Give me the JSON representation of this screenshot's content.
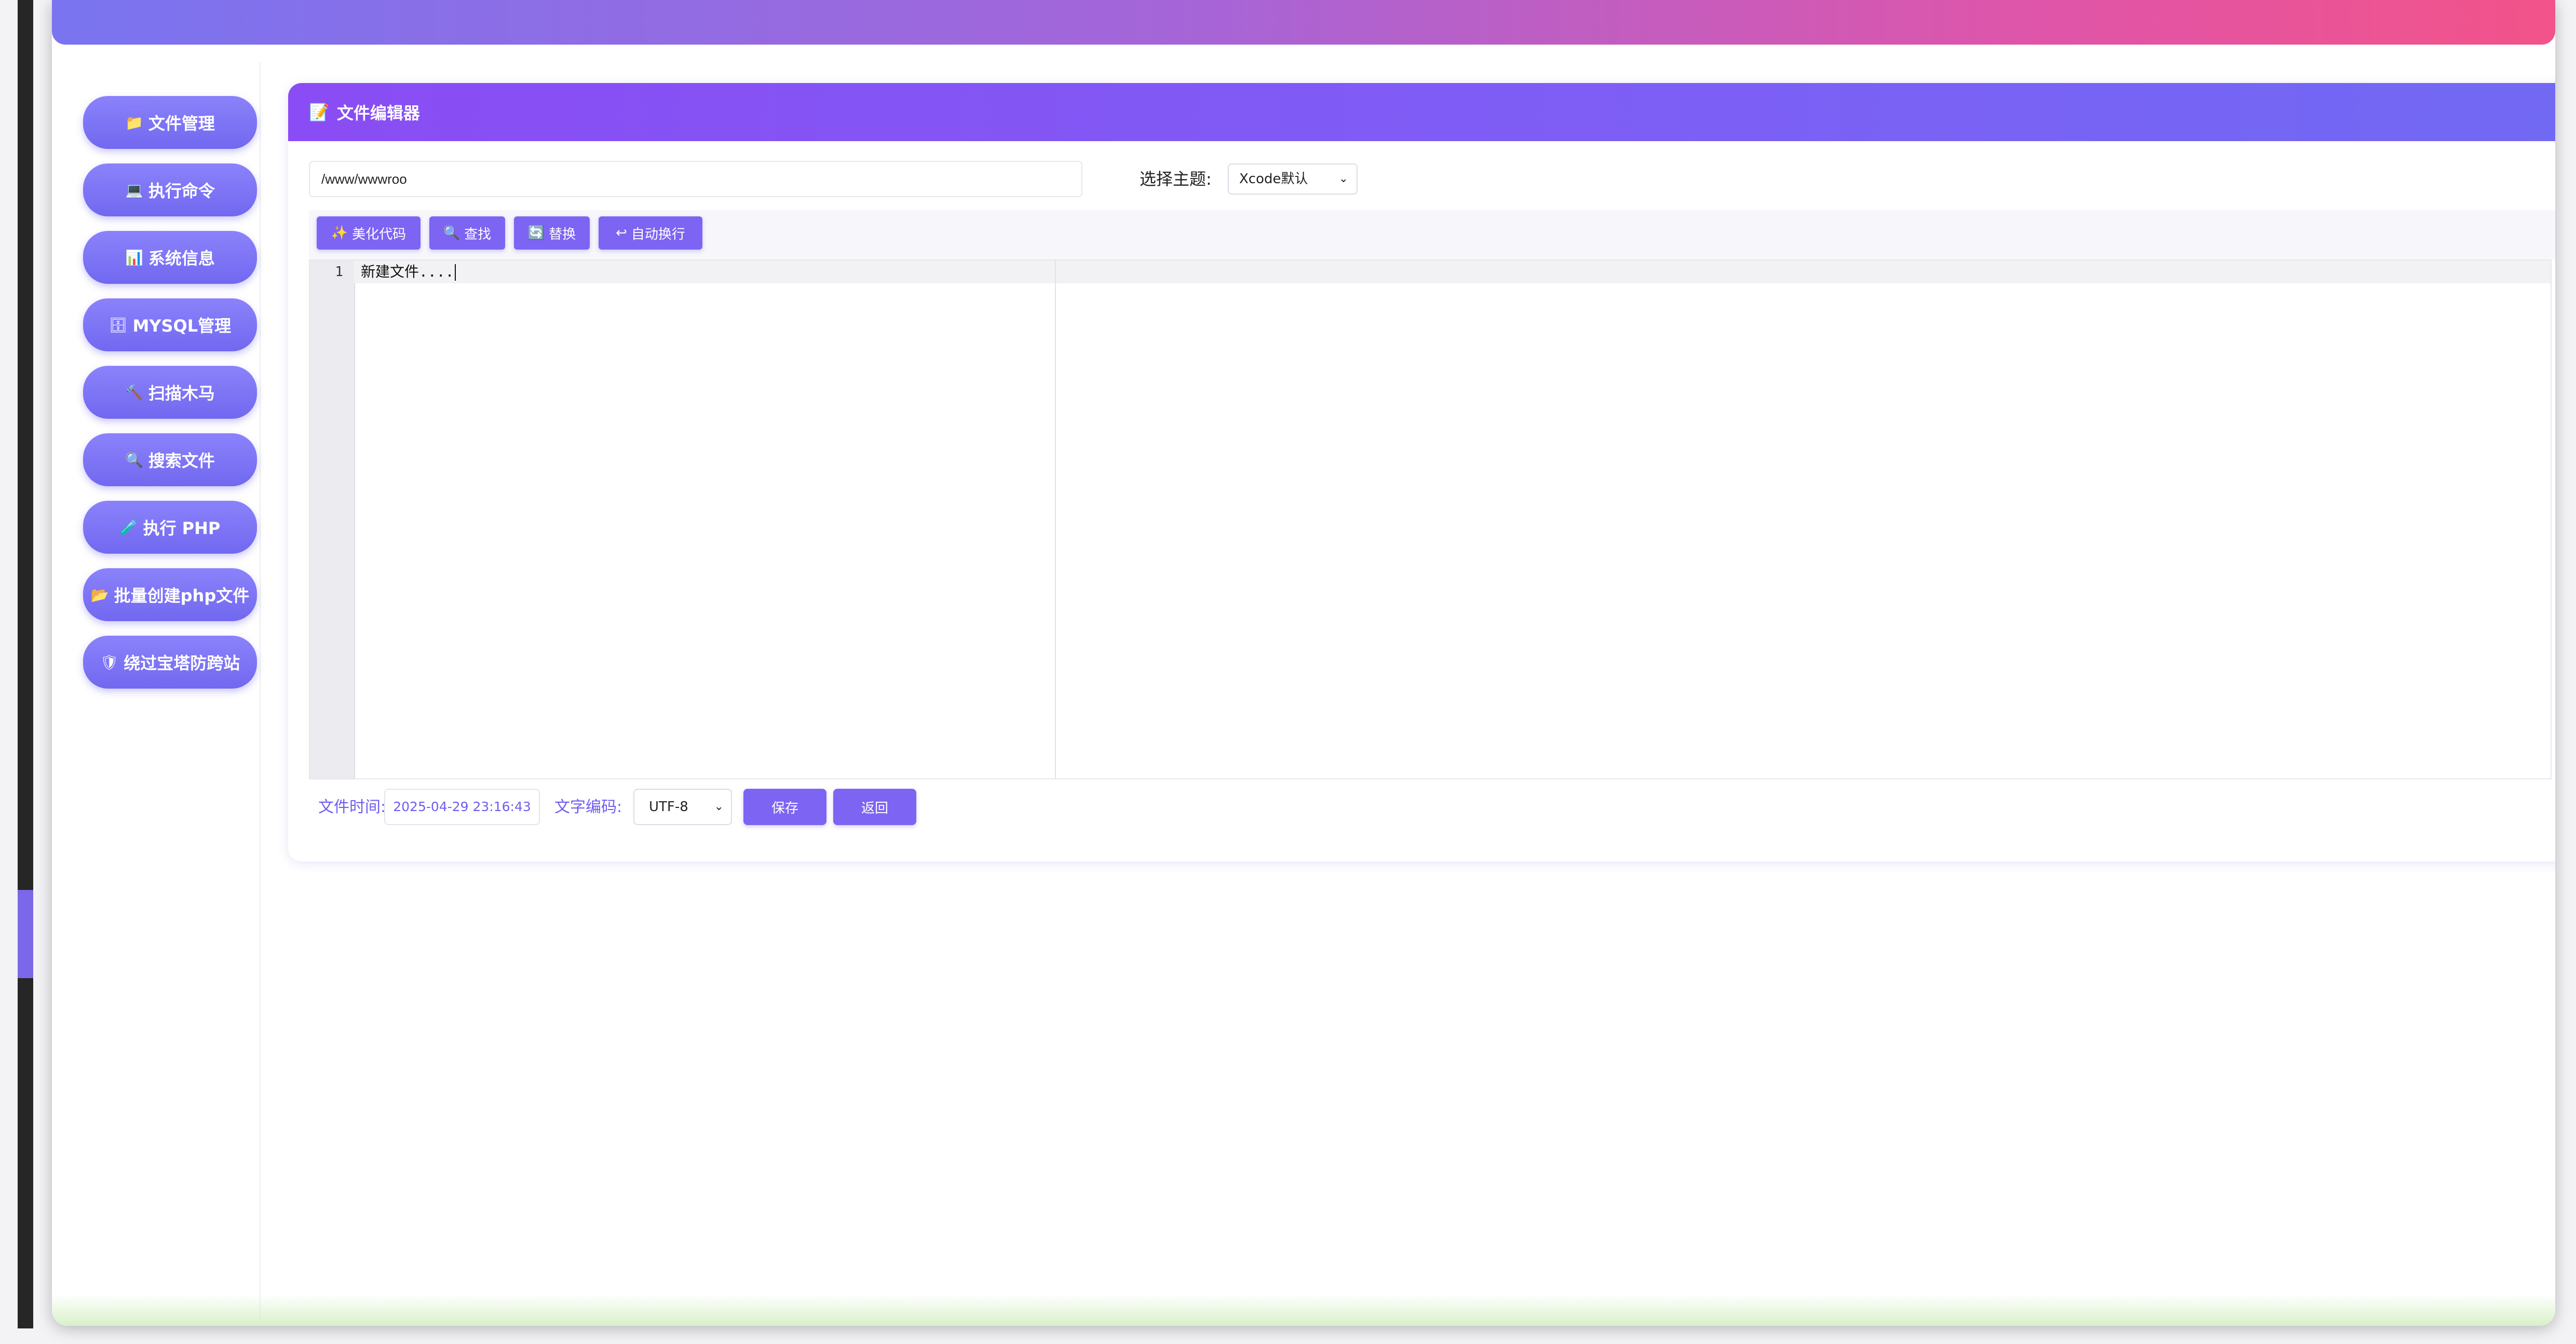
{
  "sidebar": {
    "items": [
      {
        "icon": "📁",
        "label": "文件管理"
      },
      {
        "icon": "💻",
        "label": "执行命令"
      },
      {
        "icon": "📊",
        "label": "系统信息"
      },
      {
        "icon": "🗄",
        "label": "MYSQL管理"
      },
      {
        "icon": "🔨",
        "label": "扫描木马"
      },
      {
        "icon": "🔍",
        "label": "搜索文件"
      },
      {
        "icon": "🧪",
        "label": "执行 PHP"
      },
      {
        "icon": "📂",
        "label": "批量创建php文件"
      },
      {
        "icon": "🛡",
        "label": "绕过宝塔防跨站"
      }
    ]
  },
  "editor": {
    "title_icon": "📝",
    "title": "文件编辑器",
    "path_value": "/www/wwwroo",
    "theme_label": "选择主题:",
    "theme_value": "Xcode默认",
    "toolbar": [
      {
        "icon": "✨",
        "label": "美化代码"
      },
      {
        "icon": "🔍",
        "label": "查找"
      },
      {
        "icon": "🔄",
        "label": "替换"
      },
      {
        "icon": "↩",
        "label": "自动换行"
      }
    ],
    "line_number": "1",
    "code_text": "新建文件....",
    "file_time_label": "文件时间:",
    "file_time_value": "2025-04-29 23:16:43",
    "encoding_label": "文字编码:",
    "encoding_value": "UTF-8",
    "save_label": "保存",
    "back_label": "返回"
  },
  "colors": {
    "accent": "#7d64f2",
    "sidebar_button": "#7f76f5",
    "header_gradient_start": "#8a4cf4",
    "header_gradient_end": "#7169f3"
  }
}
